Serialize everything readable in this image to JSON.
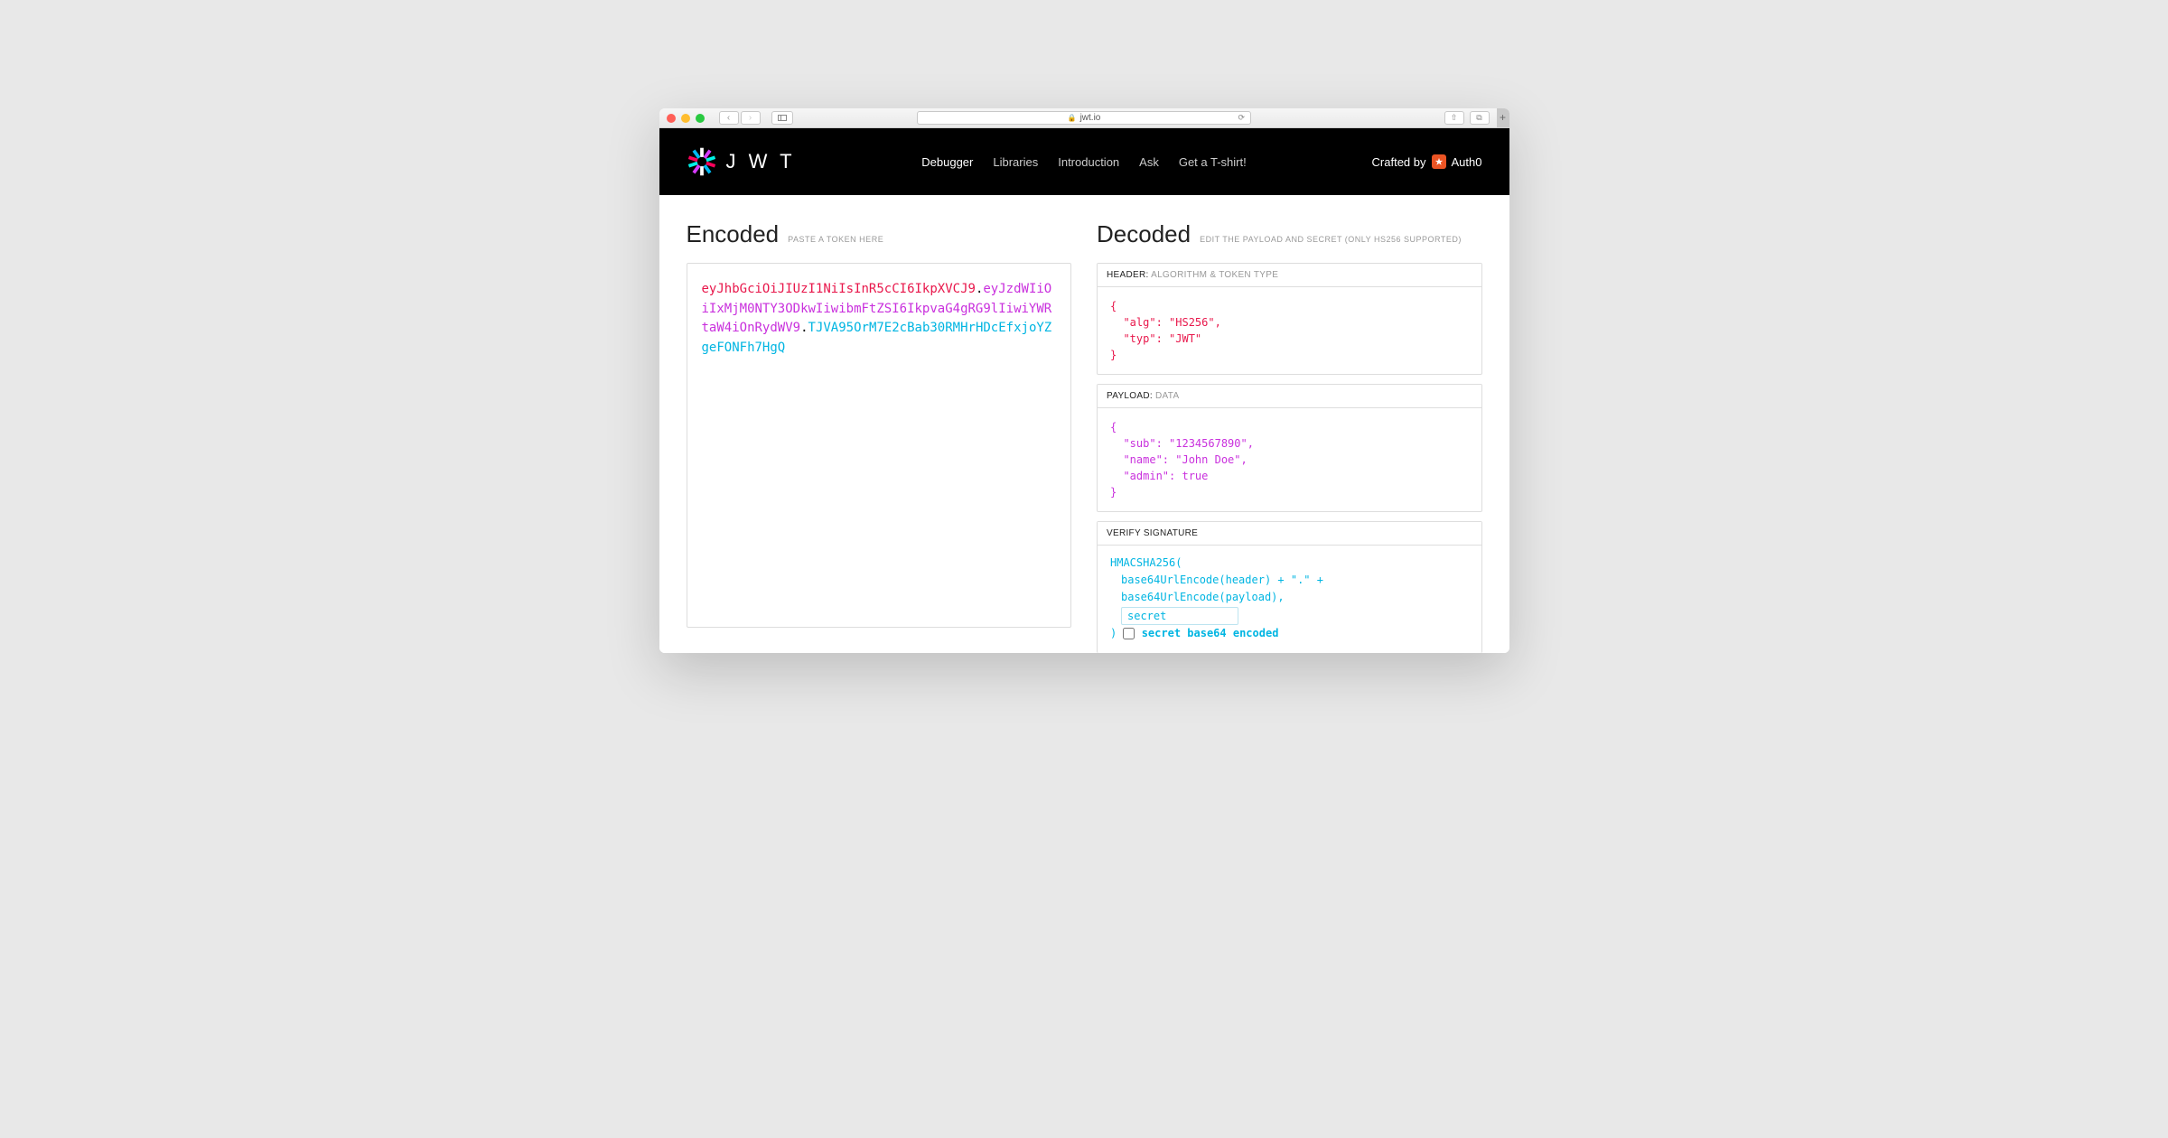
{
  "browser": {
    "url": "jwt.io"
  },
  "header": {
    "brand": "J W T",
    "nav": [
      "Debugger",
      "Libraries",
      "Introduction",
      "Ask",
      "Get a T-shirt!"
    ],
    "crafted_label": "Crafted by",
    "crafted_brand": "Auth0"
  },
  "encoded": {
    "title": "Encoded",
    "subtitle": "PASTE A TOKEN HERE",
    "token_header": "eyJhbGciOiJIUzI1NiIsInR5cCI6IkpXVCJ9",
    "token_payload": "eyJzdWIiOiIxMjM0NTY3ODkwIiwibmFtZSI6IkpvaG4gRG9lIiwiYWRtaW4iOnRydWV9",
    "token_signature": "TJVA95OrM7E2cBab30RMHrHDcEfxjoYZgeFONFh7HgQ"
  },
  "decoded": {
    "title": "Decoded",
    "subtitle": "EDIT THE PAYLOAD AND SECRET (ONLY HS256 SUPPORTED)",
    "sections": {
      "header": {
        "label": "HEADER:",
        "sub": "ALGORITHM & TOKEN TYPE",
        "json": "{\n  \"alg\": \"HS256\",\n  \"typ\": \"JWT\"\n}"
      },
      "payload": {
        "label": "PAYLOAD:",
        "sub": "DATA",
        "json": "{\n  \"sub\": \"1234567890\",\n  \"name\": \"John Doe\",\n  \"admin\": true\n}"
      },
      "signature": {
        "label": "VERIFY SIGNATURE",
        "line1": "HMACSHA256(",
        "line2": "base64UrlEncode(header) + \".\" +",
        "line3": "base64UrlEncode(payload),",
        "secret_value": "secret",
        "close": ")",
        "checkbox_label": "secret base64 encoded"
      }
    }
  }
}
